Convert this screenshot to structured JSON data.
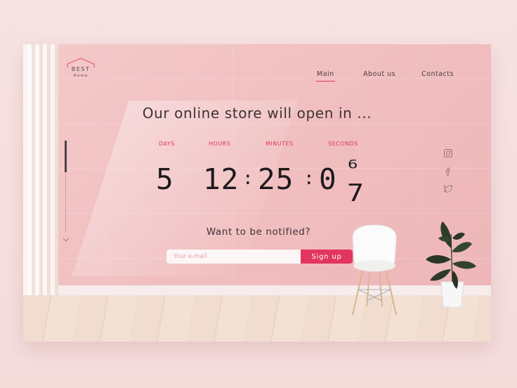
{
  "brand": {
    "line1": "BEST",
    "line2": "Home"
  },
  "nav": {
    "items": [
      {
        "label": "Main",
        "active": true
      },
      {
        "label": "About us",
        "active": false
      },
      {
        "label": "Contacts",
        "active": false
      }
    ]
  },
  "headline": "Our online store will open in ...",
  "countdown": {
    "days": {
      "label": "DAYS",
      "value": "5"
    },
    "hours": {
      "label": "HOURS",
      "value": "12"
    },
    "minutes": {
      "label": "MINUTES",
      "value": "25"
    },
    "seconds": {
      "label": "SECONDS",
      "value": "0",
      "flip_from": "6",
      "flip_to": "7"
    },
    "separator": ":"
  },
  "social": [
    "instagram-icon",
    "facebook-icon",
    "twitter-icon"
  ],
  "notify": {
    "title": "Want to be notified?",
    "email_placeholder": "Your e-mail",
    "button_label": "Sign up"
  },
  "colors": {
    "accent": "#e2355f",
    "wall": "#f2c3c4",
    "text": "#3d3336"
  }
}
